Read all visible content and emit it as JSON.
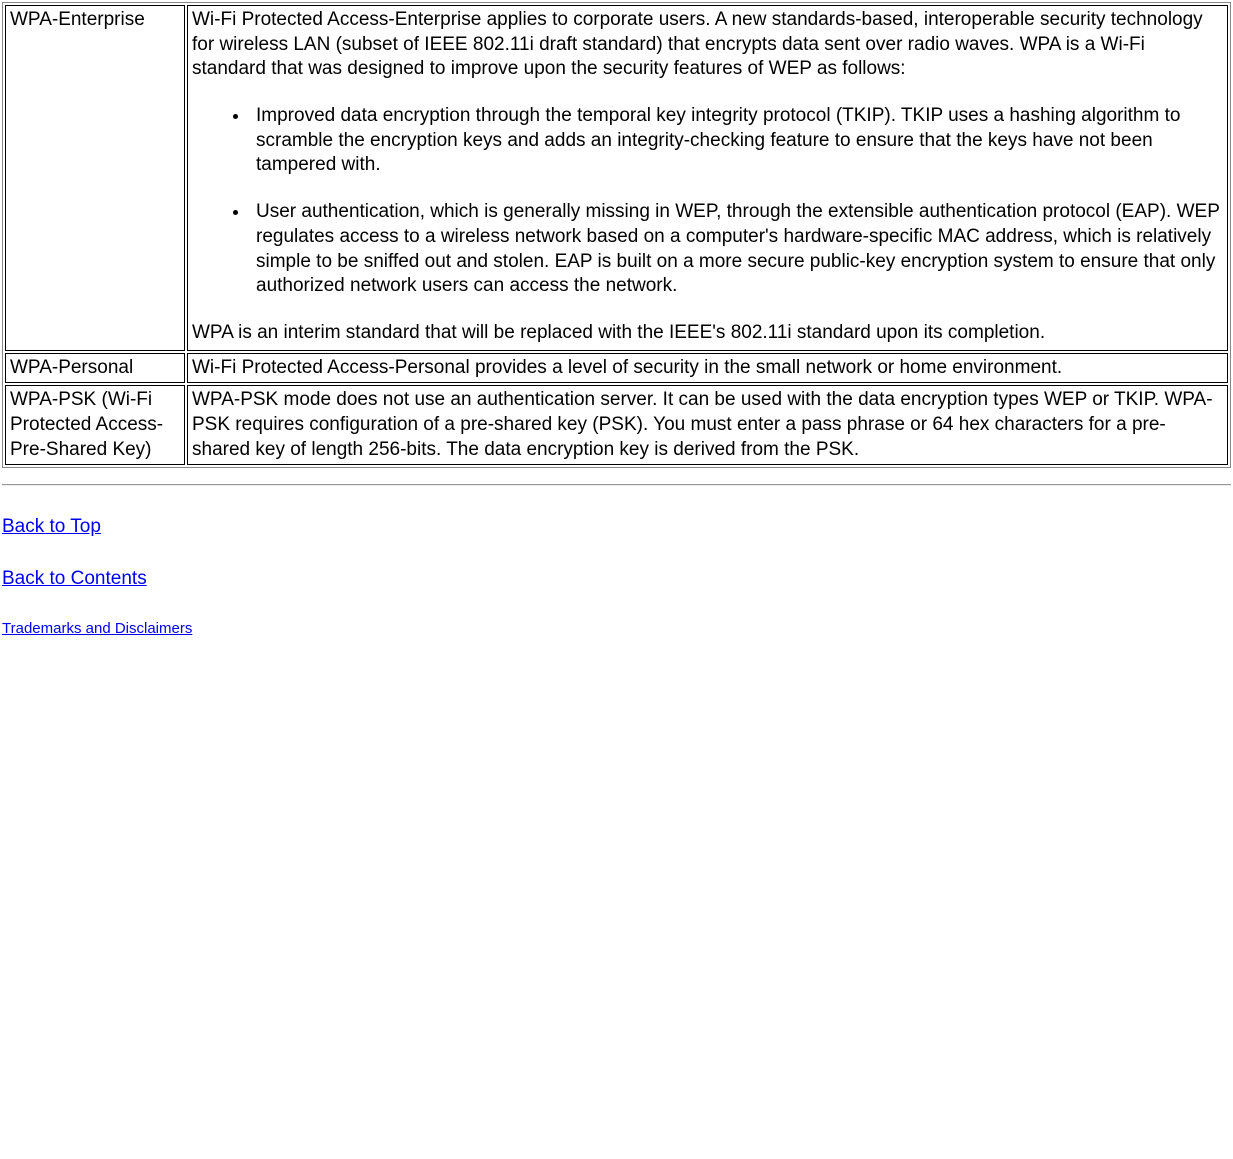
{
  "rows": [
    {
      "term": "WPA-Enterprise",
      "intro": "Wi-Fi Protected Access-Enterprise applies to corporate users. A new standards-based, interoperable security technology for wireless LAN (subset of IEEE 802.11i draft standard) that encrypts data sent over radio waves. WPA is a Wi-Fi standard that was designed to improve upon the security features of WEP as follows:",
      "bullets": [
        "Improved data encryption through the temporal key integrity protocol (TKIP). TKIP uses a hashing algorithm to scramble the encryption keys and adds an integrity-checking feature to ensure that the keys have not been tampered with.",
        "User authentication, which is generally missing in WEP, through the extensible authentication protocol (EAP). WEP regulates access to a wireless network based on a computer's hardware-specific MAC address, which is relatively simple to be sniffed out and stolen. EAP is built on a more secure public-key encryption system to ensure that only authorized network users can access the network."
      ],
      "outro": "WPA is an interim standard that will be replaced with the IEEE's 802.11i standard upon its completion."
    },
    {
      "term": "WPA-Personal",
      "definition": "Wi-Fi Protected Access-Personal provides a level of security in the small network or home environment."
    },
    {
      "term": "WPA-PSK (Wi-Fi Protected Access-Pre-Shared Key)",
      "definition": "WPA-PSK mode does not use an authentication server. It can be used with the data encryption types WEP or TKIP. WPA-PSK requires configuration of a pre-shared key (PSK). You must enter a pass phrase or 64 hex characters for a pre-shared key of length 256-bits. The data encryption key is derived from the PSK."
    }
  ],
  "links": {
    "back_to_top": "Back to Top",
    "back_to_contents": "Back to Contents",
    "trademarks": "Trademarks and Disclaimers"
  }
}
